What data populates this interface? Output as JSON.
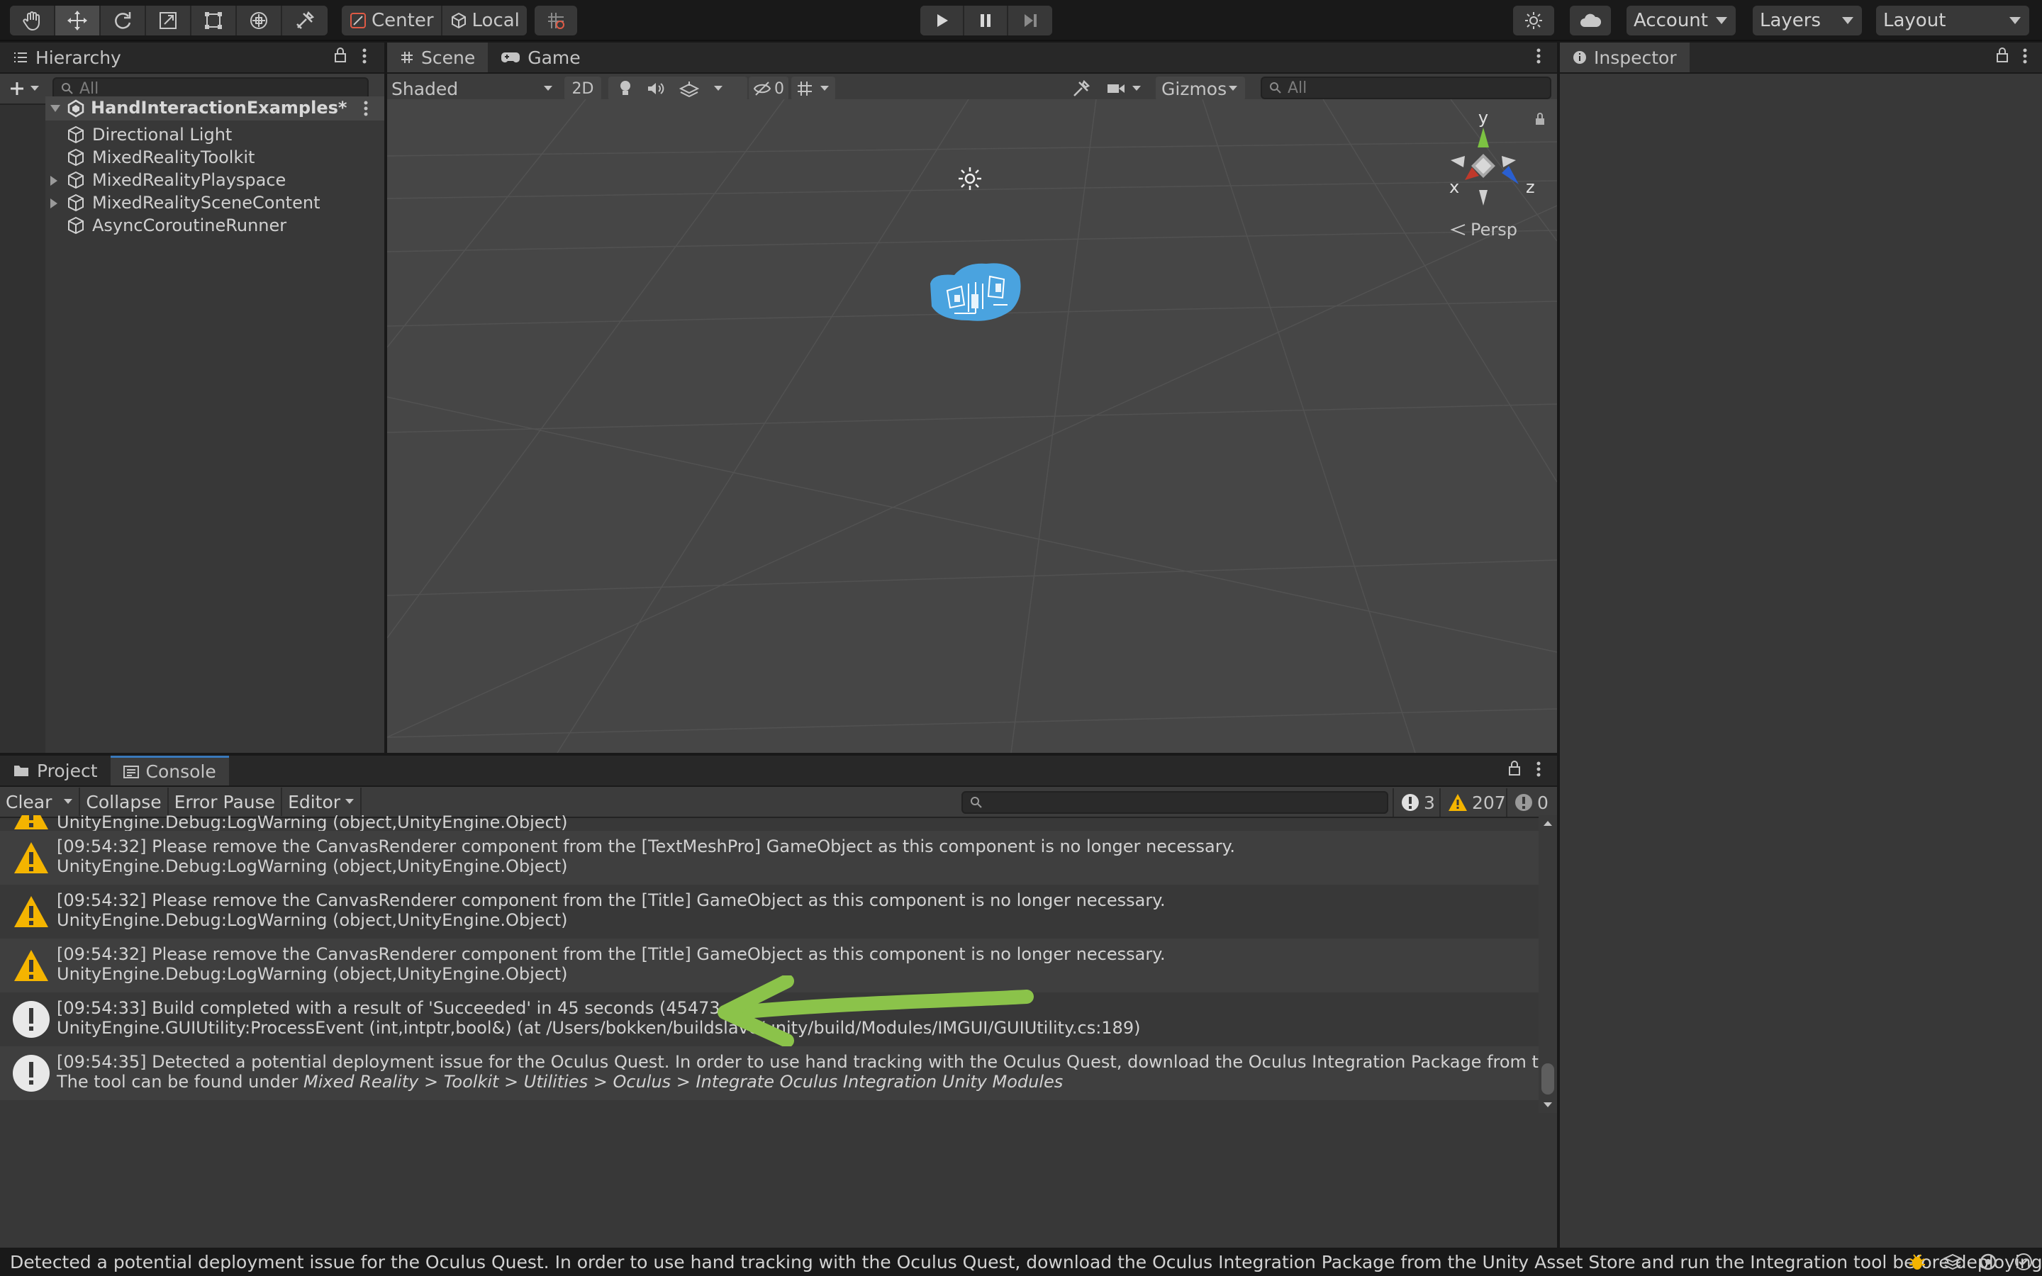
{
  "toolbar": {
    "tools": [
      "hand-tool",
      "move-tool",
      "rotate-tool",
      "scale-tool",
      "rect-tool",
      "transform-tool",
      "custom-tool"
    ],
    "pivot_mode": "Center",
    "pivot_rotation": "Local",
    "account_label": "Account",
    "layers_label": "Layers",
    "layout_label": "Layout"
  },
  "hierarchy": {
    "tab_label": "Hierarchy",
    "search_placeholder": "All",
    "scene_name": "HandInteractionExamples*",
    "items": [
      {
        "label": "Directional Light",
        "expandable": false
      },
      {
        "label": "MixedRealityToolkit",
        "expandable": false
      },
      {
        "label": "MixedRealityPlayspace",
        "expandable": true
      },
      {
        "label": "MixedRealitySceneContent",
        "expandable": true
      },
      {
        "label": "AsyncCoroutineRunner",
        "expandable": false
      }
    ]
  },
  "scene": {
    "tabs": [
      "Scene",
      "Game"
    ],
    "shading_mode": "Shaded",
    "mode_2d": "2D",
    "hidden_count": "0",
    "gizmos_label": "Gizmos",
    "search_placeholder": "All",
    "projection_label": "Persp",
    "axes": {
      "x": "x",
      "y": "y",
      "z": "z"
    }
  },
  "inspector": {
    "tab_label": "Inspector"
  },
  "console": {
    "tabs": [
      "Project",
      "Console"
    ],
    "clear_label": "Clear",
    "collapse_label": "Collapse",
    "error_pause_label": "Error Pause",
    "editor_label": "Editor",
    "info_count": "3",
    "warning_count": "207",
    "error_count": "0",
    "entries": [
      {
        "type": "warning",
        "line1": "",
        "line2": "UnityEngine.Debug:LogWarning (object,UnityEngine.Object)"
      },
      {
        "type": "warning",
        "line1": "[09:54:32] Please remove the CanvasRenderer component from the [TextMeshPro] GameObject as this component is no longer necessary.",
        "line2": "UnityEngine.Debug:LogWarning (object,UnityEngine.Object)"
      },
      {
        "type": "warning",
        "line1": "[09:54:32] Please remove the CanvasRenderer component from the [Title] GameObject as this component is no longer necessary.",
        "line2": "UnityEngine.Debug:LogWarning (object,UnityEngine.Object)"
      },
      {
        "type": "warning",
        "line1": "[09:54:32] Please remove the CanvasRenderer component from the [Title] GameObject as this component is no longer necessary.",
        "line2": "UnityEngine.Debug:LogWarning (object,UnityEngine.Object)"
      },
      {
        "type": "info",
        "line1": "[09:54:33] Build completed with a result of 'Succeeded' in 45 seconds (45473 ms)",
        "line2": "UnityEngine.GUIUtility:ProcessEvent (int,intptr,bool&) (at /Users/bokken/buildslave/unity/build/Modules/IMGUI/GUIUtility.cs:189)"
      },
      {
        "type": "info",
        "line1": "[09:54:35] Detected a potential deployment issue for the Oculus Quest. In order to use hand tracking with the Oculus Quest, download the Oculus Integration Package from the Unity Asset",
        "line2_prefix": "The tool can be found under ",
        "line2_italic": "Mixed Reality > Toolkit > Utilities > Oculus > Integrate Oculus Integration Unity Modules"
      }
    ]
  },
  "status_bar": {
    "message": "Detected a potential deployment issue for the Oculus Quest. In order to use hand tracking with the Oculus Quest, download the Oculus Integration Package from the Unity Asset Store and run the Integration tool before deploying."
  },
  "colors": {
    "accent": "#3a79bb",
    "warning": "#f4b400",
    "annotation_arrow": "#8bc34a",
    "object_selection": "#4aa3df"
  }
}
